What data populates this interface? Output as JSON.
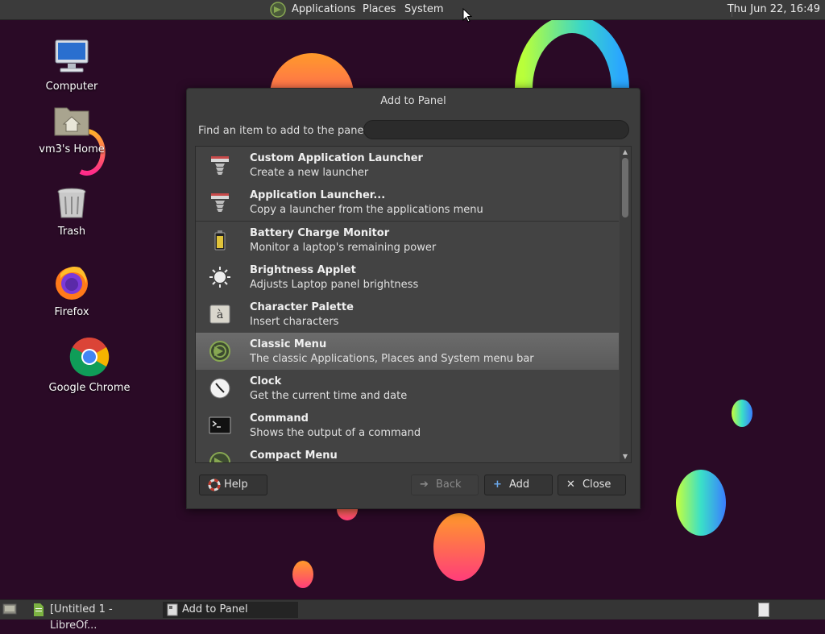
{
  "top_panel": {
    "menus": [
      "Applications",
      "Places",
      "System"
    ],
    "clock": "Thu Jun 22, 16:49"
  },
  "desktop": {
    "icons": [
      {
        "label": "Computer",
        "icon": "computer-icon"
      },
      {
        "label": "vm3's Home",
        "icon": "home-folder-icon"
      },
      {
        "label": "Trash",
        "icon": "trash-icon"
      },
      {
        "label": "Firefox",
        "icon": "firefox-icon"
      },
      {
        "label": "Google Chrome",
        "icon": "chrome-icon"
      }
    ]
  },
  "dialog": {
    "title": "Add to Panel",
    "find_label": "Find an item to add to the panel:",
    "find_value": "",
    "items": [
      {
        "title": "Custom Application Launcher",
        "desc": "Create a new launcher",
        "icon": "launcher-icon"
      },
      {
        "title": "Application Launcher...",
        "desc": "Copy a launcher from the applications menu",
        "icon": "launcher-icon"
      },
      {
        "title": "Battery Charge Monitor",
        "desc": "Monitor a laptop's remaining power",
        "icon": "battery-icon"
      },
      {
        "title": "Brightness Applet",
        "desc": "Adjusts Laptop panel brightness",
        "icon": "brightness-icon"
      },
      {
        "title": "Character Palette",
        "desc": "Insert characters",
        "icon": "character-palette-icon"
      },
      {
        "title": "Classic Menu",
        "desc": "The classic Applications, Places and System menu bar",
        "icon": "mate-menu-icon",
        "selected": true
      },
      {
        "title": "Clock",
        "desc": "Get the current time and date",
        "icon": "clock-icon"
      },
      {
        "title": "Command",
        "desc": "Shows the output of a command",
        "icon": "terminal-icon"
      },
      {
        "title": "Compact Menu",
        "desc": "",
        "icon": "mate-menu-icon"
      }
    ],
    "buttons": {
      "help": "Help",
      "back": "Back",
      "add": "Add",
      "close": "Close"
    }
  },
  "taskbar": {
    "tasks": [
      {
        "label": "[Untitled 1 - LibreOf...",
        "active": false
      },
      {
        "label": "Add to Panel",
        "active": true
      }
    ]
  },
  "colors": {
    "desktop_bg": "#2a0a26",
    "panel_bg": "#3b3b3b",
    "dialog_bg": "#3c3c3c",
    "selected_row": "#626262"
  }
}
